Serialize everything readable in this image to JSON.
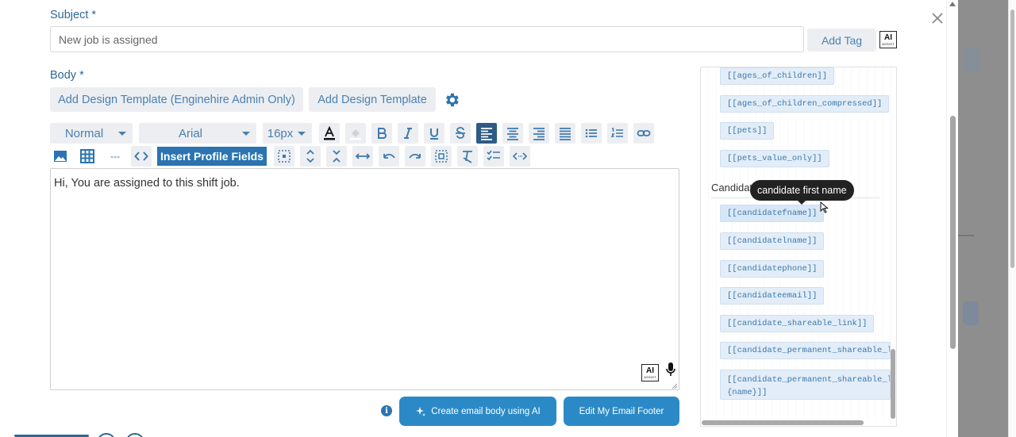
{
  "subject": {
    "label": "Subject",
    "required_mark": "*",
    "value": "New job is assigned",
    "add_tag_label": "Add Tag",
    "ai_badge": "AI",
    "ai_badge_sub": "ASSIST"
  },
  "body": {
    "label": "Body",
    "required_mark": "*",
    "add_design_admin_label": "Add Design Template (Enginehire Admin Only)",
    "add_design_label": "Add Design Template",
    "settings_icon": "gear-icon"
  },
  "toolbar": {
    "block_format": "Normal",
    "font_family": "Arial",
    "font_size": "16px",
    "insert_profile_fields_label": "Insert Profile Fields",
    "row1_buttons": [
      "text-color-icon",
      "highlight-icon",
      "bold-icon",
      "italic-icon",
      "underline-icon",
      "strikethrough-icon",
      "align-left-icon",
      "align-center-icon",
      "align-right-icon",
      "align-justify-icon",
      "bullet-list-icon",
      "numbered-list-icon",
      "link-icon"
    ],
    "row2_buttons": [
      "image-icon",
      "table-icon",
      "horizontal-rule-icon",
      "code-icon",
      "insert-profile-fields",
      "select-all-icon",
      "expand-vertical-icon",
      "collapse-vertical-icon",
      "expand-horizontal-icon",
      "undo-icon",
      "redo-icon",
      "fullscreen-icon",
      "clear-format-icon",
      "checklist-icon",
      "code-view-icon"
    ],
    "active_button": "align-left-icon",
    "hr_glyph": "---"
  },
  "editor": {
    "content": "Hi, You are assigned to this shift job.",
    "ai_badge": "AI",
    "ai_badge_sub": "ASSIST"
  },
  "actions": {
    "create_ai_label": "Create email body using AI",
    "edit_footer_label": "Edit My Email Footer",
    "info_glyph": "i"
  },
  "fields_panel": {
    "top_fields": [
      "[[ages_of_children]]",
      "[[ages_of_children_compressed]]",
      "[[pets]]",
      "[[pets_value_only]]"
    ],
    "section_title": "Candidate",
    "candidate_fields": [
      "[[candidatefname]]",
      "[[candidatelname]]",
      "[[candidatephone]]",
      "[[candidateemail]]",
      "[[candidate_shareable_link]]",
      "[[candidate_permanent_shareable_l",
      "[[candidate_permanent_shareable_l"
    ],
    "last_field_second_line": "{name}]]",
    "tooltip": "candidate first name"
  },
  "colors": {
    "accent": "#2b74b1",
    "label": "#2d6996",
    "button_grey": "#eceef1",
    "tag_bg": "#e3edf8"
  }
}
